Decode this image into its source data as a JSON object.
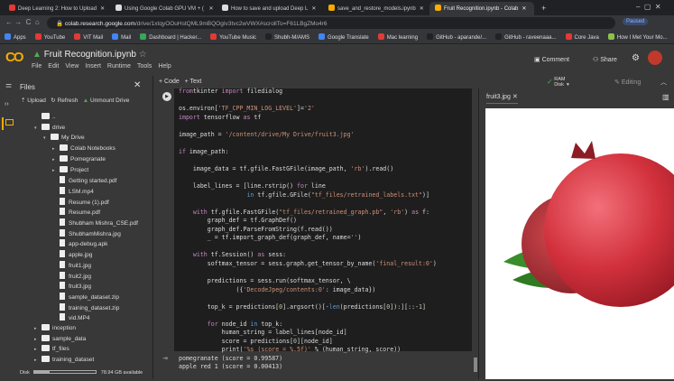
{
  "browser": {
    "tabs": [
      {
        "label": "Deep Learning 2: How to Upload",
        "color": "#e53935"
      },
      {
        "label": "Using Google Colab GPU VM + ( ",
        "color": "#ddd"
      },
      {
        "label": "How to save and upload Deep L",
        "color": "#ddd"
      },
      {
        "label": "save_and_restore_models.ipynb",
        "color": "#f9ab00"
      },
      {
        "label": "Fruit Recognition.ipynb - Colab",
        "color": "#f9ab00",
        "active": true
      }
    ],
    "new_tab": "+",
    "url_host": "colab.research.google.com",
    "url_path": "/drive/1xtqyOOuHstQML9mBQOgIv3tvc2wVWX#scrollTo=F61LBgZMo4r6",
    "paused": "Paused",
    "bookmarks": [
      {
        "label": "Apps",
        "color": "#4285f4"
      },
      {
        "label": "YouTube",
        "color": "#e53935"
      },
      {
        "label": "VIT Mail",
        "color": "#e53935"
      },
      {
        "label": "Mail",
        "color": "#4285f4"
      },
      {
        "label": "Dashboard | Hacker...",
        "color": "#34a853"
      },
      {
        "label": "YouTube Music",
        "color": "#e53935"
      },
      {
        "label": "Shubh-M/AMS",
        "color": "#222"
      },
      {
        "label": "Google Translate",
        "color": "#4285f4"
      },
      {
        "label": "Mac learning",
        "color": "#e53935"
      },
      {
        "label": "GitHub - aparande/...",
        "color": "#222"
      },
      {
        "label": "GitHub - raveenaaa...",
        "color": "#222"
      },
      {
        "label": "Core Java",
        "color": "#e53935"
      },
      {
        "label": "How I Met Your Mo...",
        "color": "#8bc34a"
      }
    ]
  },
  "colab": {
    "logo": "CO",
    "title": "Fruit Recognition.ipynb",
    "menu": [
      "File",
      "Edit",
      "View",
      "Insert",
      "Runtime",
      "Tools",
      "Help"
    ],
    "comment": "Comment",
    "share": "Share",
    "add_code": "+ Code",
    "add_text": "+ Text",
    "ram": "RAM",
    "disk": "Disk",
    "editing": "Editing"
  },
  "files": {
    "title": "Files",
    "upload": "Upload",
    "refresh": "Refresh",
    "unmount": "Unmount Drive",
    "tree": [
      {
        "name": "..",
        "type": "folder",
        "depth": 0,
        "arrow": ""
      },
      {
        "name": "drive",
        "type": "folder",
        "depth": 0,
        "arrow": "▾"
      },
      {
        "name": "My Drive",
        "type": "folder",
        "depth": 1,
        "arrow": "▾"
      },
      {
        "name": "Colab Notebooks",
        "type": "folder",
        "depth": 2,
        "arrow": "▸"
      },
      {
        "name": "Pomegranate",
        "type": "folder",
        "depth": 2,
        "arrow": "▸"
      },
      {
        "name": "Project",
        "type": "folder",
        "depth": 2,
        "arrow": "▸"
      },
      {
        "name": "Getting started.pdf",
        "type": "file",
        "depth": 2
      },
      {
        "name": "LSM.mp4",
        "type": "file",
        "depth": 2
      },
      {
        "name": "Resume (1).pdf",
        "type": "file",
        "depth": 2
      },
      {
        "name": "Resume.pdf",
        "type": "file",
        "depth": 2
      },
      {
        "name": "Shubham Mishra_CSE.pdf",
        "type": "file",
        "depth": 2
      },
      {
        "name": "ShubhamMishra.jpg",
        "type": "file",
        "depth": 2
      },
      {
        "name": "app-debug.apk",
        "type": "file",
        "depth": 2
      },
      {
        "name": "apple.jpg",
        "type": "file",
        "depth": 2
      },
      {
        "name": "fruit1.jpg",
        "type": "file",
        "depth": 2
      },
      {
        "name": "fruit2.jpg",
        "type": "file",
        "depth": 2
      },
      {
        "name": "fruit3.jpg",
        "type": "file",
        "depth": 2
      },
      {
        "name": "sample_dataset.zip",
        "type": "file",
        "depth": 2
      },
      {
        "name": "training_dataset.zip",
        "type": "file",
        "depth": 2
      },
      {
        "name": "vid.MP4",
        "type": "file",
        "depth": 2
      },
      {
        "name": "inception",
        "type": "folder",
        "depth": 0,
        "arrow": "▸"
      },
      {
        "name": "sample_data",
        "type": "folder",
        "depth": 0,
        "arrow": "▸"
      },
      {
        "name": "tf_files",
        "type": "folder",
        "depth": 0,
        "arrow": "▸"
      },
      {
        "name": "training_dataset",
        "type": "folder",
        "depth": 0,
        "arrow": "▸"
      }
    ],
    "disk_label": "Disk",
    "disk_available": "78.94 GB available",
    "disk_used_fraction": 0.25
  },
  "code_lines": [
    [
      [
        "kw",
        "from"
      ],
      [
        "",
        "tkinter "
      ],
      [
        "kw",
        "import"
      ],
      [
        "",
        " filedialog"
      ]
    ],
    [],
    [
      [
        "",
        "os.environ["
      ],
      [
        "str",
        "'TF_CPP_MIN_LOG_LEVEL'"
      ],
      [
        "",
        "]="
      ],
      [
        "str",
        "'2'"
      ]
    ],
    [
      [
        "kw",
        "import"
      ],
      [
        "",
        " tensorflow "
      ],
      [
        "kw",
        "as"
      ],
      [
        "",
        " tf"
      ]
    ],
    [],
    [
      [
        "",
        "image_path = "
      ],
      [
        "str",
        "'/content/drive/My Drive/fruit3.jpg'"
      ]
    ],
    [],
    [
      [
        "kw",
        "if"
      ],
      [
        "",
        " image_path:"
      ]
    ],
    [],
    [
      [
        "",
        "    image_data = tf.gfile.FastGFile(image_path, "
      ],
      [
        "str",
        "'rb'"
      ],
      [
        "",
        ").read()"
      ]
    ],
    [],
    [
      [
        "",
        "    label_lines = [line.rstrip() "
      ],
      [
        "kw",
        "for"
      ],
      [
        "",
        " line"
      ]
    ],
    [
      [
        "",
        "                   "
      ],
      [
        "blu",
        "in"
      ],
      [
        "",
        " tf.gfile.GFile("
      ],
      [
        "str",
        "\"tf_files/retrained_labels.txt\""
      ],
      [
        "",
        ")]"
      ]
    ],
    [],
    [
      [
        "",
        "    "
      ],
      [
        "kw",
        "with"
      ],
      [
        "",
        " tf.gfile.FastGFile("
      ],
      [
        "str",
        "\"tf_files/retrained_graph.pb\""
      ],
      [
        "",
        ", "
      ],
      [
        "str",
        "'rb'"
      ],
      [
        "",
        ") "
      ],
      [
        "kw",
        "as"
      ],
      [
        "",
        " f:"
      ]
    ],
    [
      [
        "",
        "        graph_def = tf.GraphDef()"
      ]
    ],
    [
      [
        "",
        "        graph_def.ParseFromString(f.read())"
      ]
    ],
    [
      [
        "",
        "        _ = tf.import_graph_def(graph_def, name="
      ],
      [
        "str",
        "''"
      ],
      [
        "",
        ")"
      ]
    ],
    [],
    [
      [
        "",
        "    "
      ],
      [
        "kw",
        "with"
      ],
      [
        "",
        " tf.Session() "
      ],
      [
        "kw",
        "as"
      ],
      [
        "",
        " sess:"
      ]
    ],
    [
      [
        "",
        "        softmax_tensor = sess.graph.get_tensor_by_name("
      ],
      [
        "str",
        "'final_result:0'"
      ],
      [
        "",
        ")"
      ]
    ],
    [],
    [
      [
        "",
        "        predictions = sess.run(softmax_tensor, \\"
      ]
    ],
    [
      [
        "",
        "                ({"
      ],
      [
        "str",
        "'DecodeJpeg/contents:0'"
      ],
      [
        "",
        ": image_data})"
      ]
    ],
    [],
    [
      [
        "",
        "        top_k = predictions["
      ],
      [
        "num",
        "0"
      ],
      [
        "",
        "].argsort()[-"
      ],
      [
        "blu",
        "len"
      ],
      [
        "",
        "(predictions["
      ],
      [
        "num",
        "0"
      ],
      [
        "",
        "]):][::-"
      ],
      [
        "num",
        "1"
      ],
      [
        "",
        "]"
      ]
    ],
    [],
    [
      [
        "",
        "        "
      ],
      [
        "kw",
        "for"
      ],
      [
        "",
        " node_id "
      ],
      [
        "blu",
        "in"
      ],
      [
        "",
        " top_k:"
      ]
    ],
    [
      [
        "",
        "            human_string = label_lines[node_id]"
      ]
    ],
    [
      [
        "",
        "            score = predictions["
      ],
      [
        "num",
        "0"
      ],
      [
        "",
        "][node_id]"
      ]
    ],
    [
      [
        "",
        "            print("
      ],
      [
        "str",
        "'%s (score = %.5f)'"
      ],
      [
        "",
        " % (human_string, score))"
      ]
    ]
  ],
  "output": {
    "lines": [
      "pomegranate (score = 0.99587)",
      "apple red 1 (score = 0.00413)"
    ]
  },
  "viewer": {
    "tab": "fruit3.jpg"
  }
}
